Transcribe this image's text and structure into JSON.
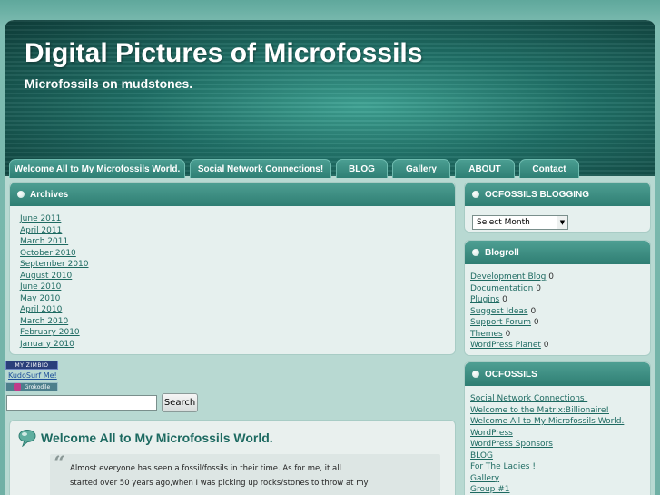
{
  "header": {
    "title": "Digital Pictures of Microfossils",
    "tagline": "Microfossils on mudstones."
  },
  "nav": {
    "tabs": [
      "Welcome All to My Microfossils World.",
      "Social Network Connections!",
      "BLOG",
      "Gallery",
      "ABOUT",
      "Contact"
    ]
  },
  "archives": {
    "title": "Archives",
    "items": [
      "June 2011",
      "April 2011",
      "March 2011",
      "October 2010",
      "September 2010",
      "August 2010",
      "June 2010",
      "May 2010",
      "April 2010",
      "March 2010",
      "February 2010",
      "January 2010"
    ]
  },
  "badges": {
    "zimbio": "MY ZIMBIO",
    "kudosurf": "KudoSurf Me!",
    "grokodile": "Grokodile"
  },
  "search": {
    "value": "",
    "button": "Search"
  },
  "post": {
    "title": "Welcome All to My Microfossils World.",
    "quote_line1": "Almost everyone has seen  a fossil/fossils in their time. As for me, it all",
    "quote_line2": "started over 50 years ago,when I was picking up rocks/stones to throw at my"
  },
  "sidebar": {
    "blogging": {
      "title": "OCFOSSILS BLOGGING",
      "select_value": "Select Month"
    },
    "blogroll": {
      "title": "Blogroll",
      "items": [
        {
          "label": "Development Blog",
          "count": "0"
        },
        {
          "label": "Documentation",
          "count": "0"
        },
        {
          "label": "Plugins",
          "count": "0"
        },
        {
          "label": "Suggest Ideas",
          "count": "0"
        },
        {
          "label": "Support Forum",
          "count": "0"
        },
        {
          "label": "Themes",
          "count": "0"
        },
        {
          "label": "WordPress Planet",
          "count": "0"
        }
      ]
    },
    "ocfossils": {
      "title": "OCFOSSILS",
      "items": [
        "Social Network Connections!",
        "Welcome to the Matrix:Billionaire!",
        "Welcome All to My Microfossils World.",
        "WordPress",
        "WordPress Sponsors",
        "BLOG",
        "For The Ladies !",
        "Gallery",
        "Group #1"
      ]
    }
  },
  "colors": {
    "accent": "#2f7e73",
    "link": "#1d6a61",
    "panel_bg": "#e6f0ee"
  }
}
